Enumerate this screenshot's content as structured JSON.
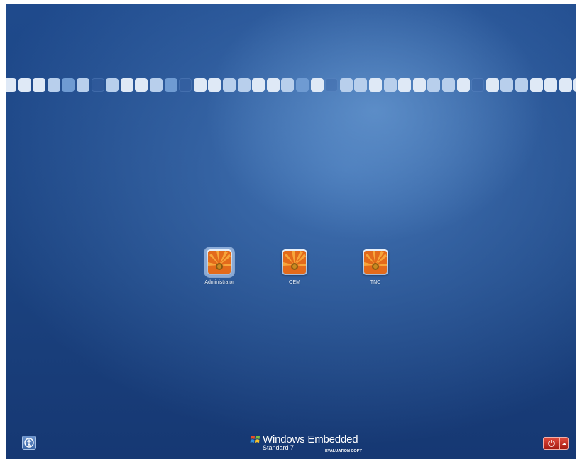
{
  "users": [
    {
      "name": "Administrator",
      "selected": true,
      "icon": "flower-picture-icon"
    },
    {
      "name": "OEM",
      "selected": false,
      "icon": "flower-picture-icon"
    },
    {
      "name": "TNC",
      "selected": false,
      "icon": "flower-picture-icon"
    }
  ],
  "footer": {
    "ease_of_access_icon": "ease-of-access-icon",
    "brand_name": "Windows Embedded",
    "brand_edition": "Standard 7",
    "evaluation_label": "EVALUATION COPY",
    "shutdown_icon": "power-icon",
    "shutdown_options_icon": "arrow-up-icon"
  },
  "colors": {
    "background": "#1f4a8c",
    "shutdown_button": "#c8302a"
  }
}
